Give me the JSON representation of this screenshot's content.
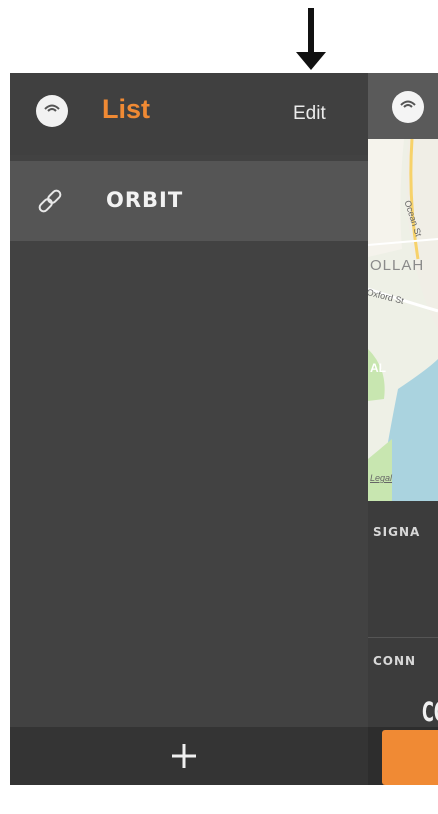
{
  "colors": {
    "accent": "#f08a34",
    "panel": "#424242",
    "selected_row": "#555555",
    "footer": "#343434",
    "map_land": "#eef0e6",
    "map_water": "#aad3df",
    "map_park": "#c8e6b0"
  },
  "drawer": {
    "title": "List",
    "edit_label": "Edit",
    "logo_icon": "wifi-signal-icon",
    "devices": [
      {
        "name": "ORBIT",
        "icon": "link-icon"
      }
    ],
    "add_icon": "plus-icon"
  },
  "peek": {
    "logo_icon": "wifi-signal-icon",
    "map_labels": {
      "street1": "Ocean St",
      "area": "OLLAH",
      "street2": "Oxford St",
      "area2": "AL",
      "legal": "Legal"
    },
    "signal_label": "SIGNA",
    "conn_label": "CONN",
    "conn_value": "CO"
  },
  "arrow_icon": "arrow-down-icon"
}
